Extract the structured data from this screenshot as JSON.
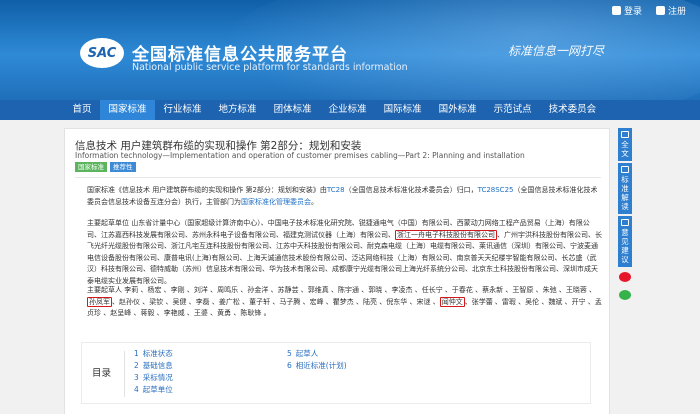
{
  "header": {
    "logo_text": "SAC",
    "title": "全国标准信息公共服务平台",
    "subtitle": "National public service platform  for standards information",
    "slogan": "标准信息一网打尽",
    "login": "登录",
    "register": "注册"
  },
  "nav": [
    "首页",
    "国家标准",
    "行业标准",
    "地方标准",
    "团体标准",
    "企业标准",
    "国际标准",
    "国外标准",
    "示范试点",
    "技术委员会"
  ],
  "nav_active_index": 1,
  "standard": {
    "title": "信息技术 用户建筑群布缆的实现和操作 第2部分：规划和安装",
    "subtitle": "Information technology—Implementation and operation of customer premises cabling—Part 2: Planning and installation",
    "tags": [
      "国家标准",
      "推荐性"
    ],
    "intro": {
      "p1": "国家标准《信息技术 用户建筑群布缆的实现和操作 第2部分：规划和安装》由",
      "tc": "TC28",
      "p2": "（全国信息技术标准化技术委员会）归口，",
      "sc": "TC28SC25",
      "p3": "（全国信息技术标准化技术委员会信息技术设备互连分会）执行，主管部门为",
      "dept": "国家标准化管理委员会",
      "p4": "。"
    },
    "units": {
      "before": "主要起草单位 山东省计量中心（国家超级计算济南中心）、中国电子技术标准化研究院、锐捷通电气（中国）有限公司、西蒙动力网络工程产品贸易（上海）有限公司、江苏嘉西科技发展有限公司、苏州永科电子设备有限公司、福建克测试仪器（上海）有限公司、",
      "highlight": "浙江一舟电子科技股份有限公司",
      "after": "、广州宇洪科技股份有限公司、长飞光纤光缆股份有限公司、浙江凡宅互连科技股份有限公司、江苏中天科技股份有限公司、耐克森电缆（上海）电缆有限公司、莱讯通信（深圳）有限公司、宁波麦通电信设备股份有限公司、康普电讯(上海)有限公司、上海天诚通信技术股份有限公司、泛达网络科技（上海）有限公司、南京普天天纪楼宇智能有限公司、长芯盛（武汉）科技有限公司、德特威勒（苏州）信息技术有限公司、华为技术有限公司、成都康宁光缆有限公司上海光纤系统分公司、北京东土科技股份有限公司、深圳市成天泰电缆实业发展有限公司。"
    },
    "people": {
      "before": "主要起草人 李莉 、杨宏 、李刚 、刘洋 、周鸣乐 、孙金洋 、苏静芸 、郭维真 、陈宇通 、郭晓 、李凌杰 、任长宁 、于春花 、蔡永新 、王智原 、朱弛 、王晓蓉 、",
      "highlight1": "孙凤军",
      "middle": "、赵孙仪 、梁钦 、吴健 、李磊 、姜广松 、董子轩 、马子腾 、宏峰 、瞿梦杰 、陆亮 、倪东华 、宋谜 、",
      "highlight2": "闻仲文",
      "after": "、张学蕾 、雷瑕 、吴伦 、魏斌 、开宁 、孟贞珍 、赵呈峰 、蒋毅 、李艳威 、王婆 、黄勇 、陈耿锋 。"
    },
    "toc": {
      "label": "目录",
      "left": [
        {
          "n": "1",
          "text": "标准状态"
        },
        {
          "n": "2",
          "text": "基础信息"
        },
        {
          "n": "3",
          "text": "采标情况"
        },
        {
          "n": "4",
          "text": "起草单位"
        }
      ],
      "right": [
        {
          "n": "5",
          "text": "起草人"
        },
        {
          "n": "6",
          "text": "相近标准(计划)"
        }
      ]
    }
  },
  "sidebar": [
    "全文",
    "标准解读",
    "意见建议"
  ],
  "sidebar_icons": [
    "weibo-icon",
    "wechat-icon"
  ]
}
